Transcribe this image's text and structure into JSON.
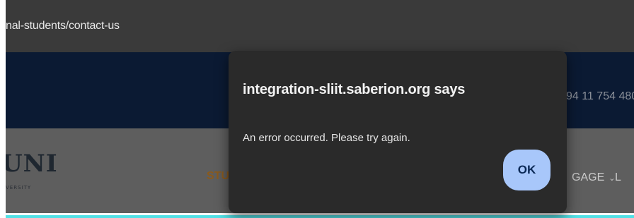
{
  "browser": {
    "url_fragment": "nal-students/contact-us"
  },
  "site": {
    "topbar": {
      "phone_fragment": "94 11 754 480"
    },
    "logo": {
      "text": "UNI",
      "subtext": "VERSITY"
    },
    "nav": {
      "stu_fragment": "STU",
      "engage_fragment": "GAGE",
      "last_fragment": "L"
    }
  },
  "dialog": {
    "title": "integration-sliit.saberion.org says",
    "message": "An error occurred. Please try again.",
    "ok_label": "OK"
  }
}
